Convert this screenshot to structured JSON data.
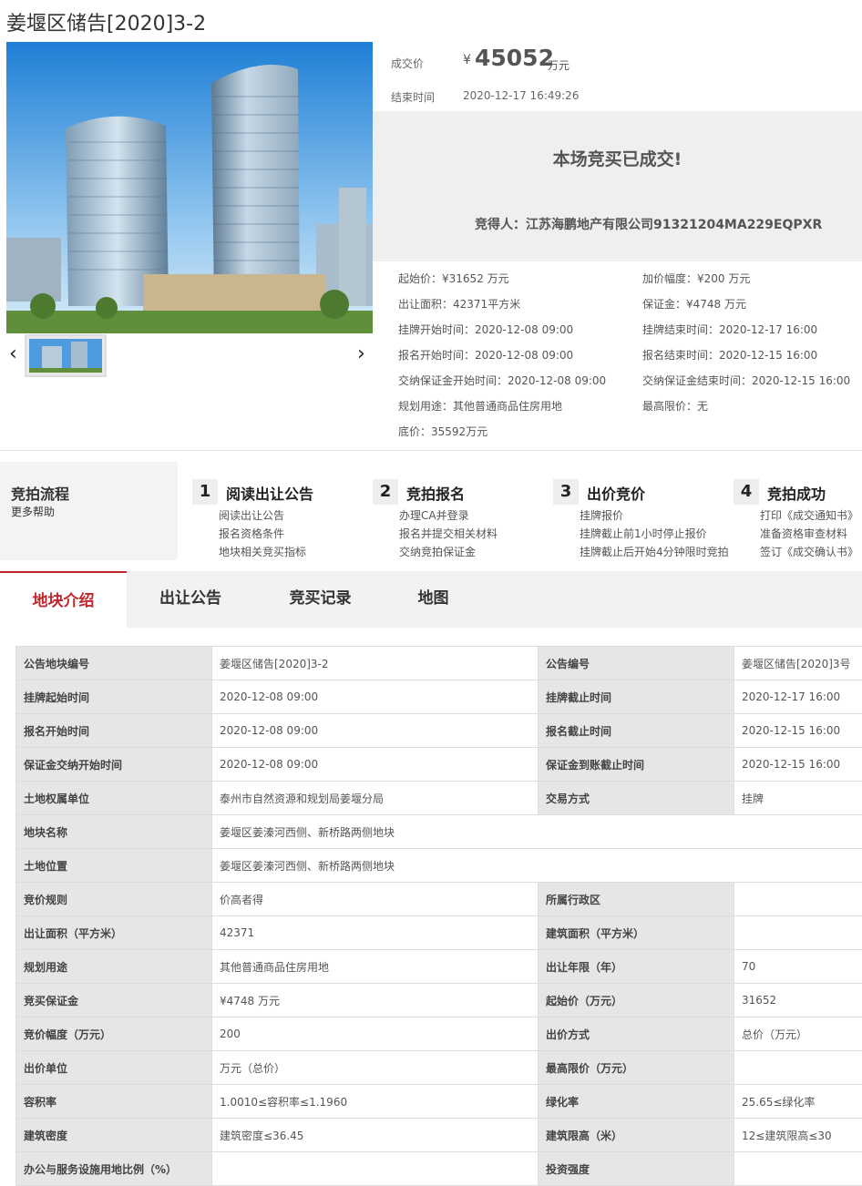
{
  "title": "姜堰区储告[2020]3-2",
  "price": {
    "deal_label": "成交价",
    "currency": "¥",
    "amount": "45052",
    "unit": "万元",
    "end_label": "结束时间",
    "end_time": "2020-12-17 16:49:26"
  },
  "deal": {
    "status": "本场竞买已成交!",
    "winner_label": "竞得人：",
    "winner": "江苏海鹏地产有限公司91321204MA229EQPXR"
  },
  "info": [
    {
      "label": "起始价：",
      "value": "¥31652 万元"
    },
    {
      "label": "加价幅度：",
      "value": "¥200 万元"
    },
    {
      "label": "出让面积：",
      "value": "42371平方米"
    },
    {
      "label": "保证金：",
      "value": "¥4748 万元"
    },
    {
      "label": "挂牌开始时间：",
      "value": "2020-12-08 09:00"
    },
    {
      "label": "挂牌结束时间：",
      "value": "2020-12-17 16:00"
    },
    {
      "label": "报名开始时间：",
      "value": "2020-12-08 09:00"
    },
    {
      "label": "报名结束时间：",
      "value": "2020-12-15 16:00"
    },
    {
      "label": "交纳保证金开始时间：",
      "value": "2020-12-08 09:00"
    },
    {
      "label": "交纳保证金结束时间：",
      "value": "2020-12-15 16:00"
    },
    {
      "label": "规划用途：",
      "value": "其他普通商品住房用地"
    },
    {
      "label": "最高限价：",
      "value": "无"
    },
    {
      "label": "底价：",
      "value": "35592万元"
    }
  ],
  "flow": {
    "title": "竞拍流程",
    "help": "更多帮助",
    "steps": [
      {
        "num": "1",
        "title": "阅读出让公告",
        "subs": [
          "阅读出让公告",
          "报名资格条件",
          "地块相关竞买指标"
        ]
      },
      {
        "num": "2",
        "title": "竞拍报名",
        "subs": [
          "办理CA并登录",
          "报名并提交相关材料",
          "交纳竞拍保证金"
        ]
      },
      {
        "num": "3",
        "title": "出价竞价",
        "subs": [
          "挂牌报价",
          "挂牌截止前1小时停止报价",
          "挂牌截止后开始4分钟限时竞拍"
        ]
      },
      {
        "num": "4",
        "title": "竞拍成功",
        "subs": [
          "打印《成交通知书》",
          "准备资格审查材料",
          "签订《成交确认书》"
        ]
      }
    ]
  },
  "tabs": [
    "地块介绍",
    "出让公告",
    "竞买记录",
    "地图"
  ],
  "table": {
    "rows": [
      [
        "公告地块编号",
        "姜堰区储告[2020]3-2",
        "公告编号",
        "姜堰区储告[2020]3号"
      ],
      [
        "挂牌起始时间",
        "2020-12-08 09:00",
        "挂牌截止时间",
        "2020-12-17 16:00"
      ],
      [
        "报名开始时间",
        "2020-12-08 09:00",
        "报名截止时间",
        "2020-12-15 16:00"
      ],
      [
        "保证金交纳开始时间",
        "2020-12-08 09:00",
        "保证金到账截止时间",
        "2020-12-15 16:00"
      ],
      [
        "土地权属单位",
        "泰州市自然资源和规划局姜堰分局",
        "交易方式",
        "挂牌"
      ],
      [
        "地块名称",
        "姜堰区姜溱河西侧、新桥路两侧地块"
      ],
      [
        "土地位置",
        "姜堰区姜溱河西侧、新桥路两侧地块"
      ],
      [
        "竞价规则",
        "价高者得",
        "所属行政区",
        ""
      ],
      [
        "出让面积（平方米）",
        "42371",
        "建筑面积（平方米）",
        ""
      ],
      [
        "规划用途",
        "其他普通商品住房用地",
        "出让年限（年）",
        "70"
      ],
      [
        "竞买保证金",
        "¥4748 万元",
        "起始价（万元）",
        "31652"
      ],
      [
        "竞价幅度（万元）",
        "200",
        "出价方式",
        "总价（万元）"
      ],
      [
        "出价单位",
        "万元（总价）",
        "最高限价（万元）",
        ""
      ],
      [
        "容积率",
        "1.0010≤容积率≤1.1960",
        "绿化率",
        "25.65≤绿化率"
      ],
      [
        "建筑密度",
        "建筑密度≤36.45",
        "建筑限高（米）",
        "12≤建筑限高≤30"
      ],
      [
        "办公与服务设施用地比例（%）",
        "",
        "投资强度",
        ""
      ]
    ]
  }
}
